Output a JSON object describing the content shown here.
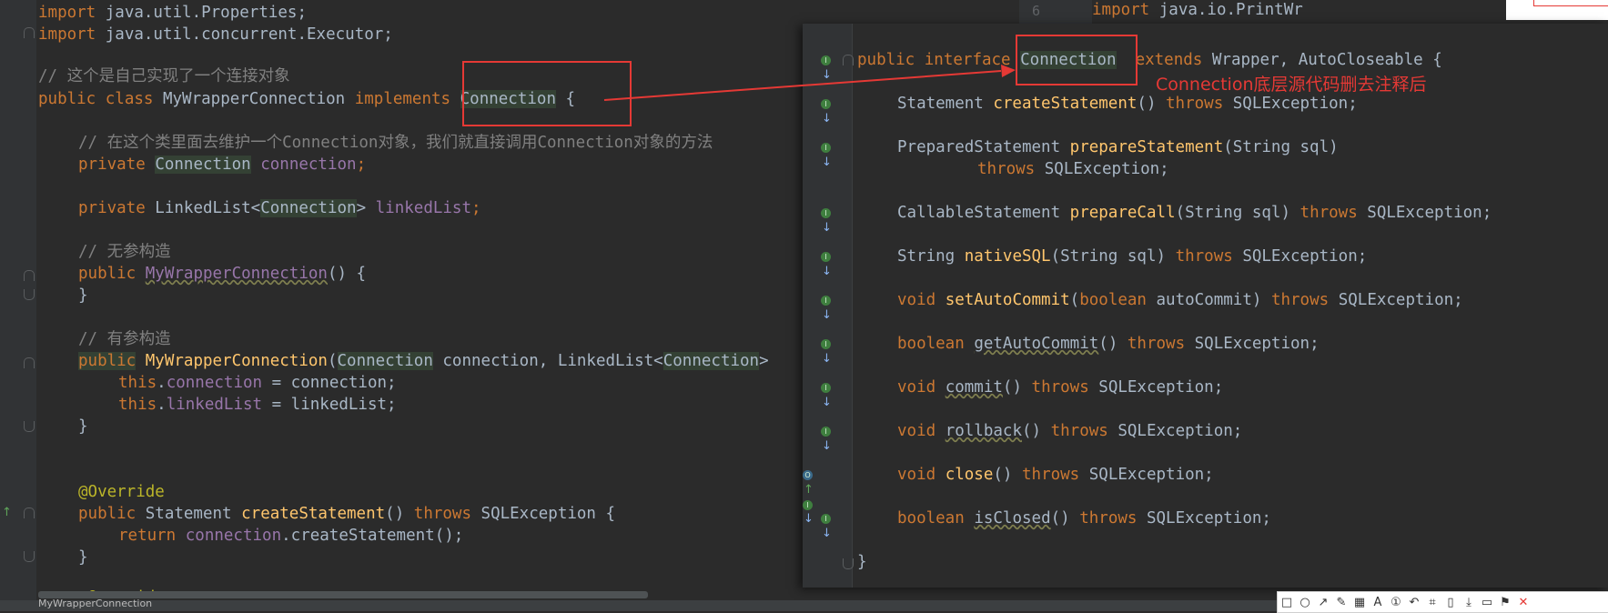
{
  "left_code": {
    "line1": {
      "kw": "import",
      "rest": " java.util.Properties;"
    },
    "line2": {
      "kw": "import",
      "rest": " java.util.concurrent.Executor;"
    },
    "comment_self": "// 这个是自己实现了一个连接对象",
    "class_decl": {
      "kw1": "public",
      "kw2": "class",
      "name": " MyWrapperConnection ",
      "kw3": "implements",
      "iface": "Connection",
      "brace": " {"
    },
    "comment_maintain": "// 在这个类里面去维护一个Connection对象，我们就直接调用Connection对象的方法",
    "field_conn": {
      "kw": "private",
      "type": "Connection",
      "name": "connection",
      "semi": ";"
    },
    "field_list": {
      "kw": "private",
      "type_pre": " LinkedList<",
      "type_gen": "Connection",
      "type_post": "> ",
      "name": "linkedList",
      "semi": ";"
    },
    "comment_noarg": "// 无参构造",
    "ctor_noarg": {
      "kw": "public",
      "name": "MyWrapperConnection",
      "rest": "() {"
    },
    "close_brace": "}",
    "comment_arg": "// 有参构造",
    "ctor_arg": {
      "kw": "public",
      "name": "MyWrapperConnection",
      "p1": "(",
      "t1": "Connection",
      "n1": " connection, LinkedList<",
      "t2": "Connection",
      "n2": ">"
    },
    "assign1": {
      "kw": "this",
      "dot": ".",
      "field": "connection",
      "rest": " = connection;"
    },
    "assign2": {
      "kw": "this",
      "dot": ".",
      "field": "linkedList",
      "rest": " = linkedList;"
    },
    "annotation": "@Override",
    "method": {
      "kw": "public",
      "type": " Statement ",
      "name": "createStatement",
      "rest": "() ",
      "kw2": "throws",
      "ex": " SQLException {"
    },
    "ret": {
      "kw": "return",
      "field": " connection",
      "rest": ".createStatement();"
    },
    "annotation2": "@Override"
  },
  "behind_line": {
    "number": "6",
    "kw": "import",
    "rest": " java.io.PrintWr"
  },
  "popup_code": {
    "decl": {
      "kw1": "public",
      "kw2": "interface",
      "name": "Connection",
      "kw3": "extends",
      "rest": " Wrapper, AutoCloseable {"
    },
    "m1": {
      "type": "Statement ",
      "name": "createStatement",
      "params": "() ",
      "throws": "throws",
      "ex": " SQLException;"
    },
    "m2a": {
      "type": "PreparedStatement ",
      "name": "prepareStatement",
      "params": "(String sql)"
    },
    "m2b": {
      "throws": "throws",
      "ex": " SQLException;"
    },
    "m3": {
      "type": "CallableStatement ",
      "name": "prepareCall",
      "params": "(String sql) ",
      "throws": "throws",
      "ex": " SQLException;"
    },
    "m4": {
      "type": "String ",
      "name": "nativeSQL",
      "params": "(String sql) ",
      "throws": "throws",
      "ex": " SQLException;"
    },
    "m5": {
      "type": "void",
      "name": "setAutoCommit",
      "p1": "(",
      "pk": "boolean",
      "params": " autoCommit) ",
      "throws": "throws",
      "ex": " SQLException;"
    },
    "m6": {
      "type": "boolean",
      "name": "getAutoCommit",
      "params": "() ",
      "throws": "throws",
      "ex": " SQLException;"
    },
    "m7": {
      "type": "void",
      "name": "commit",
      "params": "() ",
      "throws": "throws",
      "ex": " SQLException;"
    },
    "m8": {
      "type": "void",
      "name": "rollback",
      "params": "() ",
      "throws": "throws",
      "ex": " SQLException;"
    },
    "m9": {
      "type": "void",
      "name": "close",
      "params": "() ",
      "throws": "throws",
      "ex": " SQLException;"
    },
    "m10": {
      "type": "boolean",
      "name": "isClosed",
      "params": "() ",
      "throws": "throws",
      "ex": " SQLException;"
    },
    "end": "}"
  },
  "annotation_text": "Connection底层源代码删去注释后",
  "status_bar": {
    "label": "MyWrapperConnection"
  },
  "toolbar_icons": [
    "rect-icon",
    "ellipse-icon",
    "arrow-icon",
    "pen-icon",
    "mosaic-icon",
    "text-icon",
    "number-icon",
    "undo-icon",
    "crop-icon",
    "pin-icon",
    "download-icon",
    "save-icon",
    "bookmark-icon",
    "close-icon"
  ],
  "toolbar_glyphs": [
    "□",
    "○",
    "↗",
    "✎",
    "▦",
    "A",
    "①",
    "↶",
    "⌗",
    "▯",
    "⤓",
    "▭",
    "⚑",
    "✕"
  ],
  "colors": {
    "keyword": "#cc7832",
    "field": "#9876aa",
    "method": "#ffc66d",
    "comment": "#808080",
    "annotation_red": "#e53935",
    "text": "#a9b7c6",
    "background": "#2b2b2b"
  }
}
